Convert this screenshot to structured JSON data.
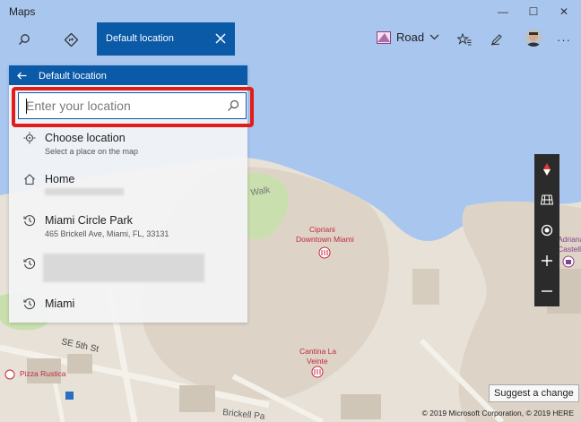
{
  "app": {
    "title": "Maps"
  },
  "window": {
    "minimize_glyph": "—",
    "maximize_glyph": "☐",
    "close_glyph": "✕"
  },
  "toolbar": {
    "search_icon": "search-icon",
    "directions_icon": "directions-icon",
    "tab_label": "Default location",
    "view_label": "Road",
    "more_glyph": "···"
  },
  "panel": {
    "header_title": "Default location",
    "search_placeholder": "Enter your location",
    "items": [
      {
        "title": "Choose location",
        "subtitle": "Select a place on the map",
        "icon": "choose-location-icon"
      },
      {
        "title": "Home",
        "subtitle": "",
        "icon": "home-icon"
      },
      {
        "title": "Miami Circle Park",
        "subtitle": "465 Brickell Ave, Miami, FL, 33131",
        "icon": "history-icon"
      },
      {
        "title": "",
        "subtitle": "",
        "icon": "history-icon"
      },
      {
        "title": "Miami",
        "subtitle": "",
        "icon": "history-icon"
      }
    ]
  },
  "map": {
    "labels": {
      "walk": "Walk",
      "cipriani_1": "Cipriani",
      "cipriani_2": "Downtown Miami",
      "adriana_1": "Adriana",
      "adriana_2": "Castelle",
      "se5th": "SE 5th St",
      "cantina_1": "Cantina La",
      "cantina_2": "Veinte",
      "pizza": "Pizza Rustica",
      "brickell": "Brickell Pa"
    },
    "suggest_label": "Suggest a change",
    "copyright": "© 2019 Microsoft Corporation, © 2019 HERE"
  },
  "colors": {
    "accent": "#0a5aa8",
    "highlight_box": "#e21b1b",
    "water": "#a9c6ef",
    "land": "#e8e2d8",
    "park": "#c9dfae",
    "poi": "#d7263d"
  }
}
